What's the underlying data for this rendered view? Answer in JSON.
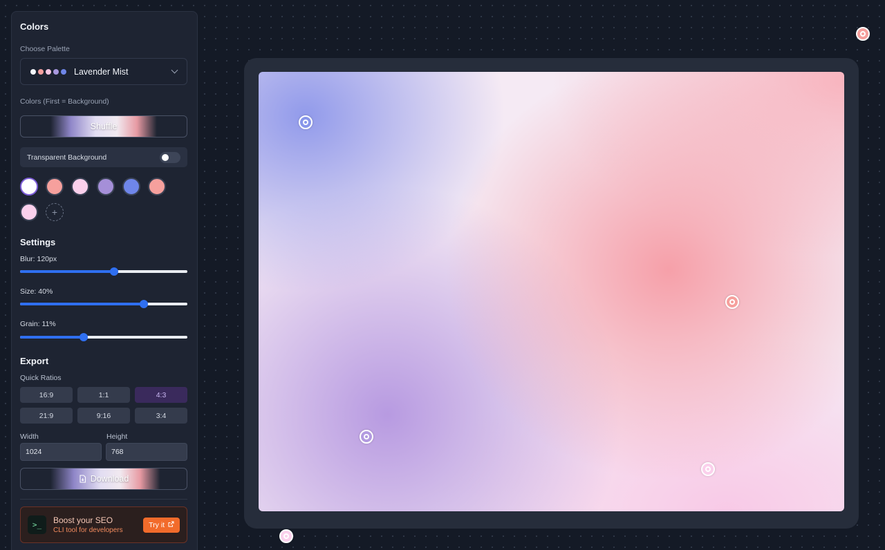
{
  "sidebar": {
    "colors_heading": "Colors",
    "choose_palette_label": "Choose Palette",
    "palette": {
      "name": "Lavender Mist",
      "dots": [
        "#f4f6fb",
        "#f4a09f",
        "#f7c7e3",
        "#a898de",
        "#6f86e8"
      ]
    },
    "colors_label": "Colors (First = Background)",
    "shuffle_label": "Shuffle",
    "transparent_label": "Transparent Background",
    "transparent_enabled": false,
    "swatches": [
      "#ffffff",
      "#f6a09d",
      "#fbd0ec",
      "#a58fd8",
      "#6f86ea",
      "#f6a09d",
      "#fbd0ec"
    ],
    "add_color_glyph": "+",
    "settings_heading": "Settings",
    "blur": {
      "label": "Blur: 120px",
      "fraction": 0.56
    },
    "size": {
      "label": "Size: 40%",
      "fraction": 0.74
    },
    "grain": {
      "label": "Grain: 11%",
      "fraction": 0.38
    },
    "export_heading": "Export",
    "quick_ratios_label": "Quick Ratios",
    "ratios": [
      "16:9",
      "1:1",
      "4:3",
      "21:9",
      "9:16",
      "3:4"
    ],
    "active_ratio": "4:3",
    "width_label": "Width",
    "height_label": "Height",
    "width_value": "1024",
    "height_value": "768",
    "download_label": "Download",
    "promo": {
      "icon_glyph": ">_",
      "title": "Boost your SEO",
      "subtitle": "CLI tool for developers",
      "cta": "Try it"
    }
  },
  "canvas": {
    "point_colors": [
      "#8896ea",
      "#f6a09d",
      "#b39be0",
      "#fbd0ec",
      "#f6a09d",
      "#fbd0ec"
    ]
  },
  "colors": {
    "accent": "#2f6ff0",
    "selected_ratio_bg": "#3a2a5c",
    "promo_cta": "#f26b2b"
  }
}
